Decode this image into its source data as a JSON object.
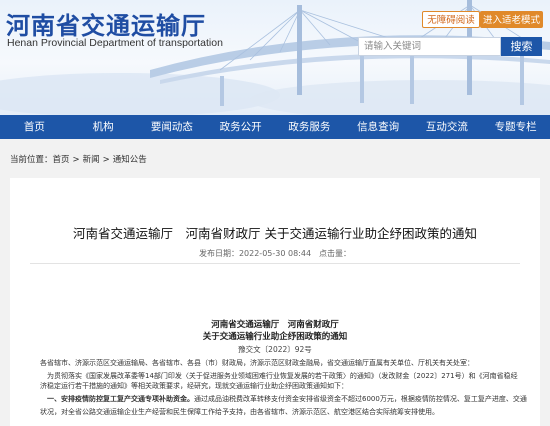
{
  "header": {
    "site_name": "河南省交通运输厅",
    "site_name_en": "Henan Provincial Department of transportation",
    "barrier_free_label": "无障碍阅读",
    "elder_mode_label": "进入适老模式",
    "search_placeholder": "请输入关键词",
    "search_button": "搜索"
  },
  "nav": {
    "items": [
      "首页",
      "机构",
      "要闻动态",
      "政务公开",
      "政务服务",
      "信息查询",
      "互动交流",
      "专题专栏"
    ]
  },
  "breadcrumb": {
    "prefix": "当前位置：",
    "items": [
      "首页",
      "新闻",
      "通知公告"
    ],
    "separator": ">"
  },
  "article": {
    "title": "河南省交通运输厅　河南省财政厅 关于交通运输行业助企纾困政策的通知",
    "meta": "发布日期：2022-05-30 08:44　点击量：",
    "doc_issuers": "河南省交通运输厅　河南省财政厅",
    "doc_title": "关于交通运输行业助企纾困政策的通知",
    "doc_number": "豫交文〔2022〕92号",
    "p1": "各省辖市、济源示范区交通运输局、各省辖市、各县（市）财政局，济源示范区财政金融局，省交通运输厅直属有关单位、厅机关有关处室：",
    "p2": "为贯彻落实《国家发展改革委等14部门印发〈关于促进服务业领域困难行业恢复发展的若干政策〉的通知》（发改财金〔2022〕271号）和《河南省稳经",
    "p3": "济稳定运行若干措施的通知》等相关政策要求，经研究，现就交通运输行业助企纾困政策通知如下：",
    "p4_bold": "一、安排疫情防控复工复产交通专项补助资金。",
    "p4_rest": "通过成品油税费改革转移支付资金安排省级资金不超过6000万元，根据疫情防控情况、复工复产进度、交通运输业发展",
    "p5": "状况，对全省公路交通运输企业生产经营和民生保障工作给予支持，由各省辖市、济源示范区、航空港区结合实际统筹安排使用。"
  }
}
